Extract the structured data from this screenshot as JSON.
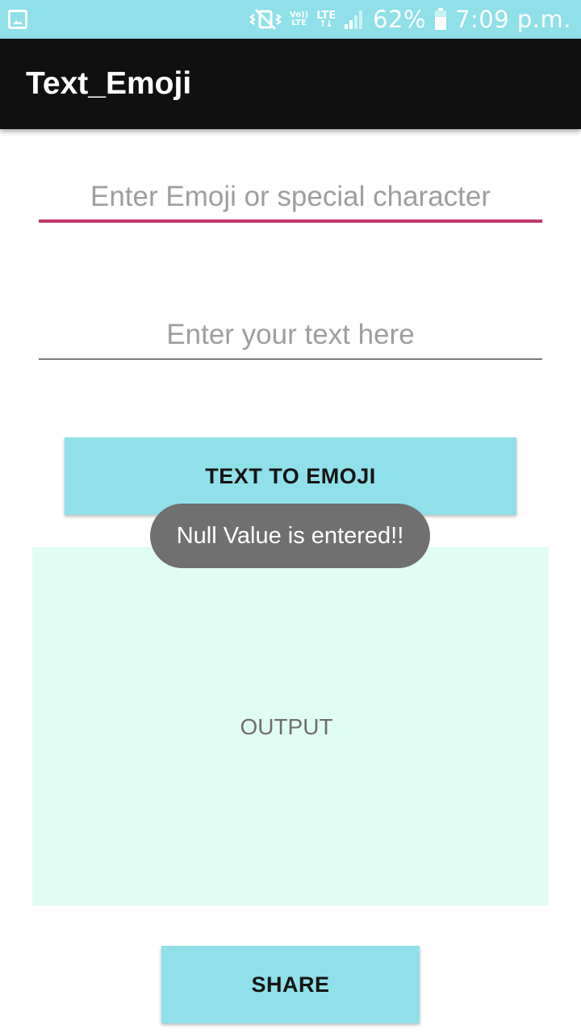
{
  "status_bar": {
    "battery_percent": "62%",
    "time": "7:09 p.m.",
    "volte_label_top": "Vo))",
    "volte_label_bottom": "LTE",
    "network_label": "LTE",
    "icons": [
      "image-notification-icon",
      "mute-vibrate-icon",
      "volte-icon",
      "lte-icon",
      "signal-icon",
      "battery-icon"
    ],
    "background_color": "#8fe0e9"
  },
  "app_bar": {
    "title": "Text_Emoji",
    "background_color": "#101010"
  },
  "form": {
    "emoji_input": {
      "value": "",
      "placeholder": "Enter Emoji or special character",
      "underline_color": "#c2366c"
    },
    "text_input": {
      "value": "",
      "placeholder": "Enter your text here"
    }
  },
  "buttons": {
    "convert_label": "TEXT TO EMOJI",
    "share_label": "SHARE",
    "color": "#8fe0e9"
  },
  "output": {
    "label": "OUTPUT",
    "background_color": "#e0fdf4"
  },
  "toast": {
    "message": "Null Value is entered!!"
  }
}
